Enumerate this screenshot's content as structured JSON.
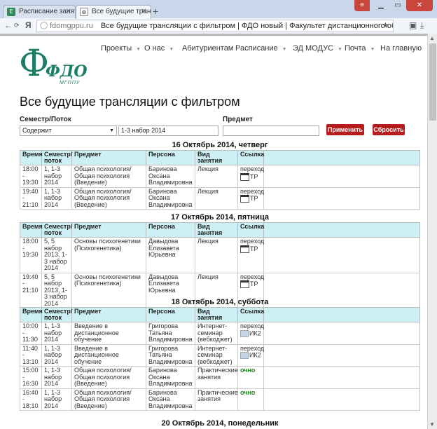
{
  "browser": {
    "tabs": [
      {
        "label": "Расписание занятий - "
      },
      {
        "label": "Все будущие трансля"
      }
    ],
    "new_tab": "+",
    "url_domain": "fdomgppu.ru",
    "url_title": "Все будущие трансляции с фильтром | ФДО новый | Факультет дистанционного обучени...",
    "yandex": "Я"
  },
  "logo": {
    "phi": "Ф",
    "fdo": "ФДО",
    "sub": "МГППУ"
  },
  "nav": [
    {
      "label": "Проекты",
      "caret": true
    },
    {
      "label": "О нас",
      "caret": true
    },
    {
      "label": "Абитуриентам",
      "caret": false
    },
    {
      "label": "Расписание",
      "caret": true
    },
    {
      "label": "ЭД МОДУС",
      "caret": true
    },
    {
      "label": "Почта",
      "caret": true
    },
    {
      "label": "На главную",
      "caret": false
    }
  ],
  "page_title": "Все будущие трансляции с фильтром",
  "filter": {
    "semester_label": "Семестр/Поток",
    "semester_select": "Содержит",
    "semester_value": "1-3 набор 2014",
    "subject_label": "Предмет",
    "subject_value": "",
    "apply": "Применить",
    "reset": "Сбросить"
  },
  "columns": [
    "Время",
    "Семестр/ поток",
    "Предмет",
    "Персона",
    "Вид занятия",
    "Ссылка"
  ],
  "days": [
    {
      "title": "16 Октябрь 2014, четверг",
      "rows": [
        {
          "time": "18:00 - 19:30",
          "sem": "1, 1-3 набор 2014",
          "subject": "Общая психология/Общая психология (Введение)",
          "person": "Баринова Оксана Владимировна",
          "kind": "Лекция",
          "link": "переход",
          "link_tag": "ТР",
          "link_type": "tp"
        },
        {
          "time": "19:40 - 21:10",
          "sem": "1, 1-3 набор 2014",
          "subject": "Общая психология/Общая психология (Введение)",
          "person": "Баринова Оксана Владимировна",
          "kind": "Лекция",
          "link": "переход",
          "link_tag": "ТР",
          "link_type": "tp"
        }
      ]
    },
    {
      "title": "17 Октябрь 2014, пятница",
      "rows": [
        {
          "time": "18:00 - 19:30",
          "sem": "5, 5 набор 2013, 1-3 набор 2014",
          "subject": "Основы психогенетики (Психогенетика)",
          "person": "Давыдова Елизавета Юрьевна",
          "kind": "Лекция",
          "link": "переход",
          "link_tag": "ТР",
          "link_type": "tp"
        },
        {
          "time": "19:40 - 21:10",
          "sem": "5, 5 набор 2013, 1-3 набор 2014",
          "subject": "Основы психогенетики (Психогенетика)",
          "person": "Давыдова Елизавета Юрьевна",
          "kind": "Лекция",
          "link": "переход",
          "link_tag": "ТР",
          "link_type": "tp"
        }
      ]
    },
    {
      "title": "18 Октябрь 2014, суббота",
      "rows": [
        {
          "time": "10:00 - 11:30",
          "sem": "1, 1-3 набор 2014",
          "subject": "Введение в дистанционное обучение",
          "person": "Григорова Татьяна Владимировна",
          "kind": "Интернет-семинар (вебкоджет)",
          "link": "переход",
          "link_tag": "ИК2",
          "link_type": "ik"
        },
        {
          "time": "11:40 - 13:10",
          "sem": "1, 1-3 набор 2014",
          "subject": "Введение в дистанционное обучение",
          "person": "Григорова Татьяна Владимировна",
          "kind": "Интернет-семинар (вебкоджет)",
          "link": "переход",
          "link_tag": "ИК2",
          "link_type": "ik"
        },
        {
          "time": "15:00 - 16:30",
          "sem": "1, 1-3 набор 2014",
          "subject": "Общая психология/Общая психология (Введение)",
          "person": "Баринова Оксана Владимировна",
          "kind": "Практические занятия",
          "link": "очно",
          "link_tag": "",
          "link_type": "och"
        },
        {
          "time": "16:40 - 18:10",
          "sem": "1, 1-3 набор 2014",
          "subject": "Общая психология/Общая психология (Введение)",
          "person": "Баринова Оксана Владимировна",
          "kind": "Практические занятия",
          "link": "очно",
          "link_tag": "",
          "link_type": "och"
        }
      ]
    }
  ],
  "next_day": "20 Октябрь 2014, понедельник"
}
